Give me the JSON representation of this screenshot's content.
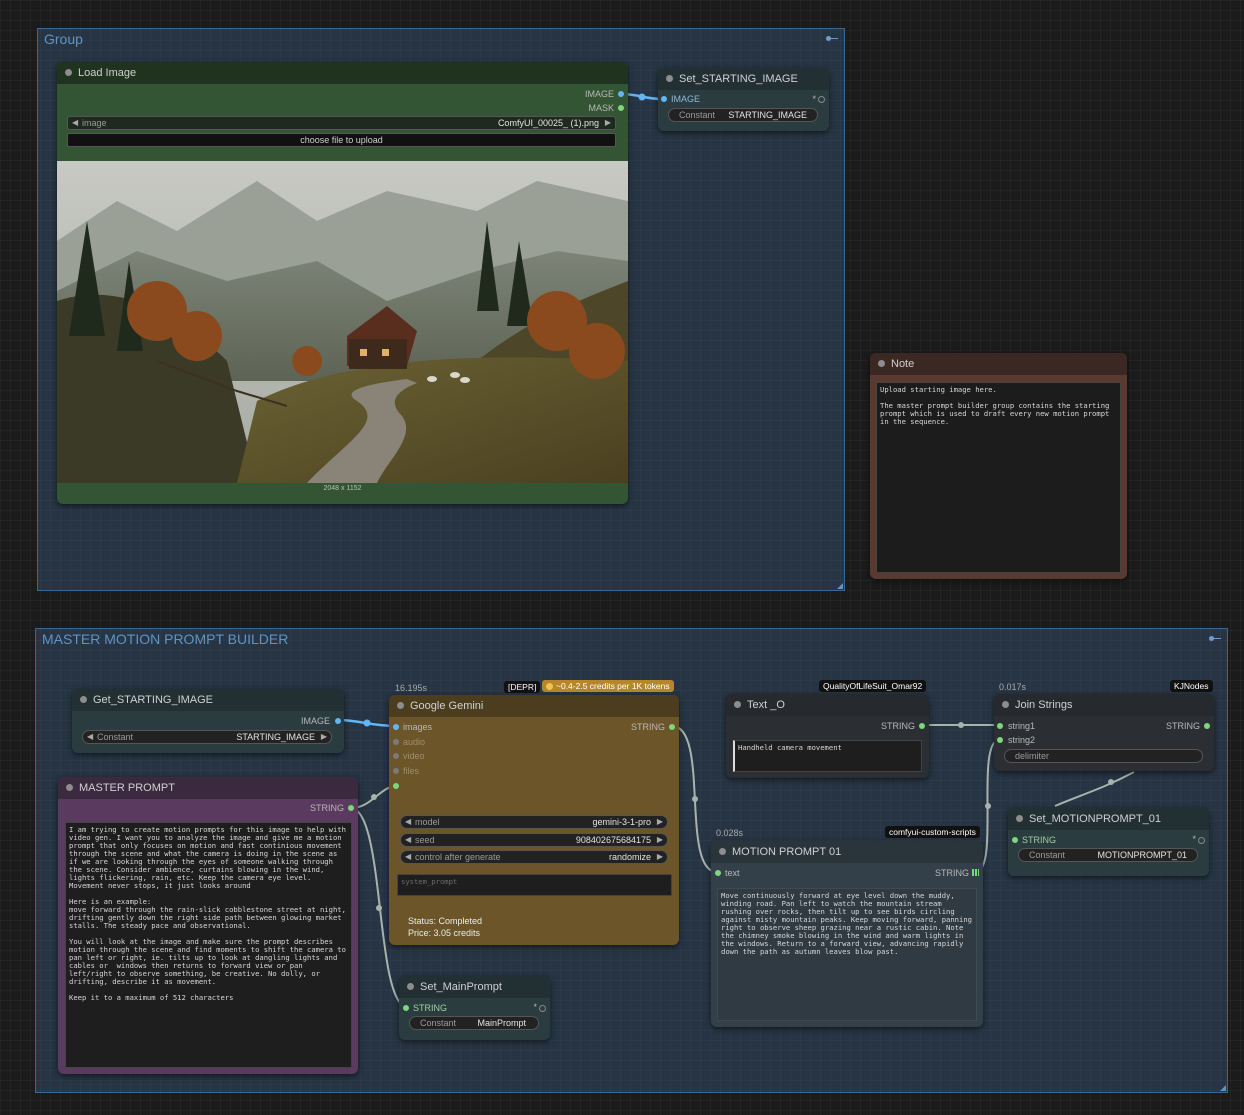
{
  "groups": {
    "top": {
      "title": "Group"
    },
    "bottom": {
      "title": "MASTER MOTION PROMPT BUILDER"
    }
  },
  "load_image": {
    "title": "Load Image",
    "outputs": [
      "IMAGE",
      "MASK"
    ],
    "image_widget": {
      "label": "image",
      "value": "ComfyUI_00025_ (1).png"
    },
    "upload_button": "choose file to upload",
    "dimensions": "2048 x 1152"
  },
  "set_starting_image": {
    "title": "Set_STARTING_IMAGE",
    "input": "IMAGE",
    "constant_label": "Constant",
    "constant_value": "STARTING_IMAGE"
  },
  "note": {
    "title": "Note",
    "text": "Upload starting image here.\n\nThe master prompt builder group contains the starting prompt which is used to draft every new motion prompt in the sequence."
  },
  "get_starting_image": {
    "title": "Get_STARTING_IMAGE",
    "output": "IMAGE",
    "constant_label": "Constant",
    "constant_value": "STARTING_IMAGE"
  },
  "master_prompt": {
    "title": "MASTER PROMPT",
    "output": "STRING",
    "text": "I am trying to create motion prompts for this image to help with video gen. I want you to analyze the image and give me a motion prompt that only focuses on motion and fast continious movement through the scene and what the camera is doing in the scene as if we are looking through the eyes of someone walking through the scene. Consider ambience, curtains blowing in the wind, lights flickering, rain, etc. Keep the camera eye level. Movement never stops, it just looks around\n\nHere is an example:\nmove forward through the rain-slick cobblestone street at night, drifting gently down the right side path between glowing market stalls. The steady pace and observational.\n\nYou will look at the image and make sure the prompt describes motion through the scene and find moments to shift the camera to pan left or right, ie. tilts up to look at dangling lights and cables or  windows then returns to forward view or pan left/right to observe something, be creative. No dolly, or drifting, describe it as movement.\n\nKeep it to a maximum of 512 characters"
  },
  "gemini": {
    "timing": "16.195s",
    "badge_depr": "[DEPR]",
    "badge_price": "~0.4-2.5 credits per 1K tokens",
    "title": "Google Gemini",
    "inputs": [
      "images",
      "audio",
      "video",
      "files"
    ],
    "output": "STRING",
    "model": {
      "label": "model",
      "value": "gemini-3-1-pro"
    },
    "seed": {
      "label": "seed",
      "value": "908402675684175"
    },
    "control": {
      "label": "control after generate",
      "value": "randomize"
    },
    "system_prompt_placeholder": "system_prompt",
    "status": "Status: Completed",
    "price": "Price: 3.05 credits"
  },
  "set_mainprompt": {
    "title": "Set_MainPrompt",
    "input": "STRING",
    "constant_label": "Constant",
    "constant_value": "MainPrompt"
  },
  "text_o": {
    "badge": "QualityOfLifeSuit_Omar92",
    "title": "Text _O",
    "output": "STRING",
    "text": "Handheld camera movement"
  },
  "join_strings": {
    "timing": "0.017s",
    "badge": "KJNodes",
    "title": "Join Strings",
    "inputs": [
      "string1",
      "string2"
    ],
    "output": "STRING",
    "delimiter": "delimiter"
  },
  "motion_prompt": {
    "timing": "0.028s",
    "badge": "comfyui-custom-scripts",
    "title": "MOTION PROMPT 01",
    "input": "text",
    "output": "STRING",
    "text": "Move continuously forward at eye level down the muddy, winding road. Pan left to watch the mountain stream rushing over rocks, then tilt up to see birds circling against misty mountain peaks. Keep moving forward, panning right to observe sheep grazing near a rustic cabin. Note the chimney smoke blowing in the wind and warm lights in the windows. Return to a forward view, advancing rapidly down the path as autumn leaves blow past."
  },
  "set_motionprompt": {
    "title": "Set_MOTIONPROMPT_01",
    "input": "STRING",
    "constant_label": "Constant",
    "constant_value": "MOTIONPROMPT_01"
  },
  "colors": {
    "image_link": "#64b5f6",
    "string_link": "#9aa7a0"
  }
}
